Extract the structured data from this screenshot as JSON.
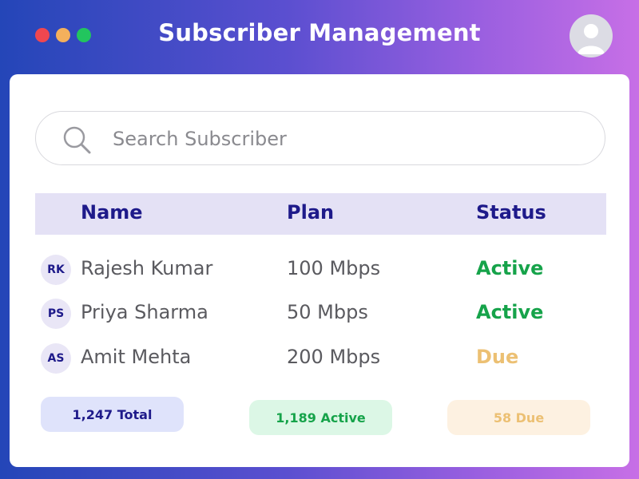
{
  "header": {
    "title": "Subscriber Management",
    "window_dots": [
      "#f0474f",
      "#f4b05c",
      "#22c55e"
    ],
    "avatar_icon": "user-icon"
  },
  "search": {
    "placeholder": "Search Subscriber",
    "value": "",
    "icon": "search-icon"
  },
  "table": {
    "columns": [
      "Name",
      "Plan",
      "Status"
    ],
    "rows": [
      {
        "initials": "RK",
        "name": "Rajesh Kumar",
        "plan": "100 Mbps",
        "status": "Active"
      },
      {
        "initials": "PS",
        "name": "Priya Sharma",
        "plan": "50 Mbps",
        "status": "Active"
      },
      {
        "initials": "AS",
        "name": "Amit Mehta",
        "plan": "200 Mbps",
        "status": "Due"
      }
    ]
  },
  "summary": {
    "total": "1,247 Total",
    "active": "1,189 Active",
    "due": "58 Due"
  },
  "colors": {
    "active": "#16a34a",
    "due": "#ecc073",
    "header_text": "#1e1a8a"
  }
}
